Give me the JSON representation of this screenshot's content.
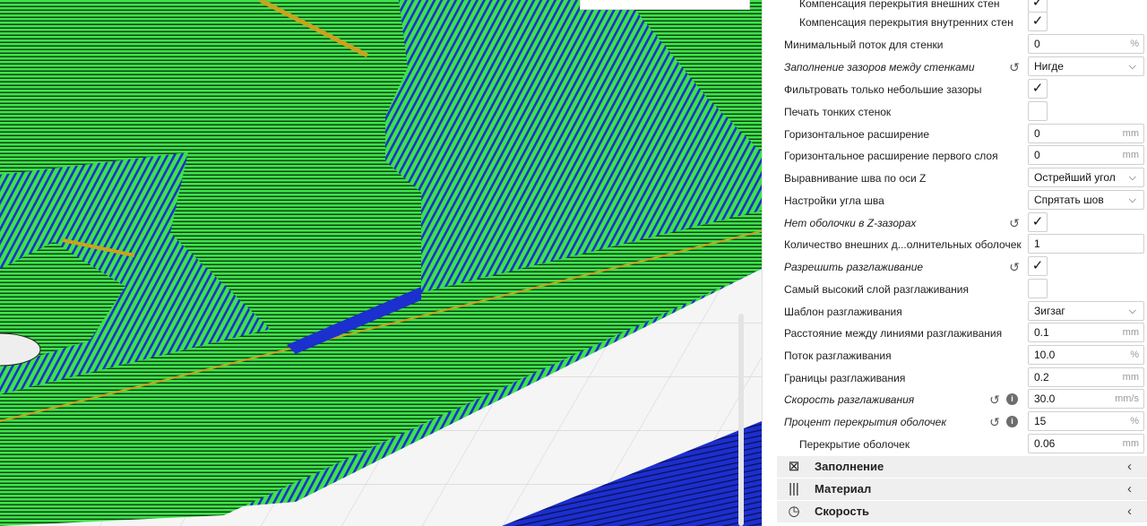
{
  "settings": [
    {
      "label": "Компенсация перекрытия внешних стен",
      "kind": "checkbox",
      "checked": true,
      "indent": true
    },
    {
      "label": "Компенсация перекрытия внутренних стен",
      "kind": "checkbox",
      "checked": true,
      "indent": true
    },
    {
      "label": "Минимальный поток для стенки",
      "kind": "field",
      "value": "0",
      "unit": "%"
    },
    {
      "label": "Заполнение зазоров между стенками",
      "kind": "select",
      "value": "Нигде",
      "italic": true,
      "reset": true
    },
    {
      "label": "Фильтровать только небольшие зазоры",
      "kind": "checkbox",
      "checked": true
    },
    {
      "label": "Печать тонких стенок",
      "kind": "checkbox",
      "checked": false
    },
    {
      "label": "Горизонтальное расширение",
      "kind": "field",
      "value": "0",
      "unit": "mm"
    },
    {
      "label": "Горизонтальное расширение первого слоя",
      "kind": "field",
      "value": "0",
      "unit": "mm"
    },
    {
      "label": "Выравнивание шва по оси Z",
      "kind": "select",
      "value": "Острейший угол"
    },
    {
      "label": "Настройки угла шва",
      "kind": "select",
      "value": "Спрятать шов"
    },
    {
      "label": "Нет оболочки в Z-зазорах",
      "kind": "checkbox",
      "checked": true,
      "italic": true,
      "reset": true
    },
    {
      "label": "Количество внешних д...олнительных оболочек",
      "kind": "field",
      "value": "1",
      "unit": ""
    },
    {
      "label": "Разрешить разглаживание",
      "kind": "checkbox",
      "checked": true,
      "italic": true,
      "reset": true
    },
    {
      "label": "Самый высокий слой разглаживания",
      "kind": "checkbox",
      "checked": false
    },
    {
      "label": "Шаблон разглаживания",
      "kind": "select",
      "value": "Зигзаг"
    },
    {
      "label": "Расстояние между линиями разглаживания",
      "kind": "field",
      "value": "0.1",
      "unit": "mm"
    },
    {
      "label": "Поток разглаживания",
      "kind": "field",
      "value": "10.0",
      "unit": "%"
    },
    {
      "label": "Границы разглаживания",
      "kind": "field",
      "value": "0.2",
      "unit": "mm"
    },
    {
      "label": "Скорость разглаживания",
      "kind": "field",
      "value": "30.0",
      "unit": "mm/s",
      "italic": true,
      "reset": true,
      "info": true
    },
    {
      "label": "Процент перекрытия оболочек",
      "kind": "field",
      "value": "15",
      "unit": "%",
      "italic": true,
      "reset": true,
      "info": true
    },
    {
      "label": "Перекрытие оболочек",
      "kind": "field",
      "value": "0.06",
      "unit": "mm",
      "indent": true
    }
  ],
  "categories": [
    {
      "label": "Заполнение",
      "icon": "infill-icon"
    },
    {
      "label": "Материал",
      "icon": "material-icon"
    },
    {
      "label": "Скорость",
      "icon": "speed-icon"
    }
  ],
  "icons": {
    "check": "✓",
    "reset": "↺",
    "info": "i",
    "chevron_down": "⌵",
    "chevron_left": "‹"
  },
  "colors": {
    "wall_green": "#3ee24a",
    "line_blue": "#1c2fcf",
    "seam_yellow": "#c9a31c",
    "panel_bg": "#ffffff",
    "category_bg": "#efefef"
  }
}
